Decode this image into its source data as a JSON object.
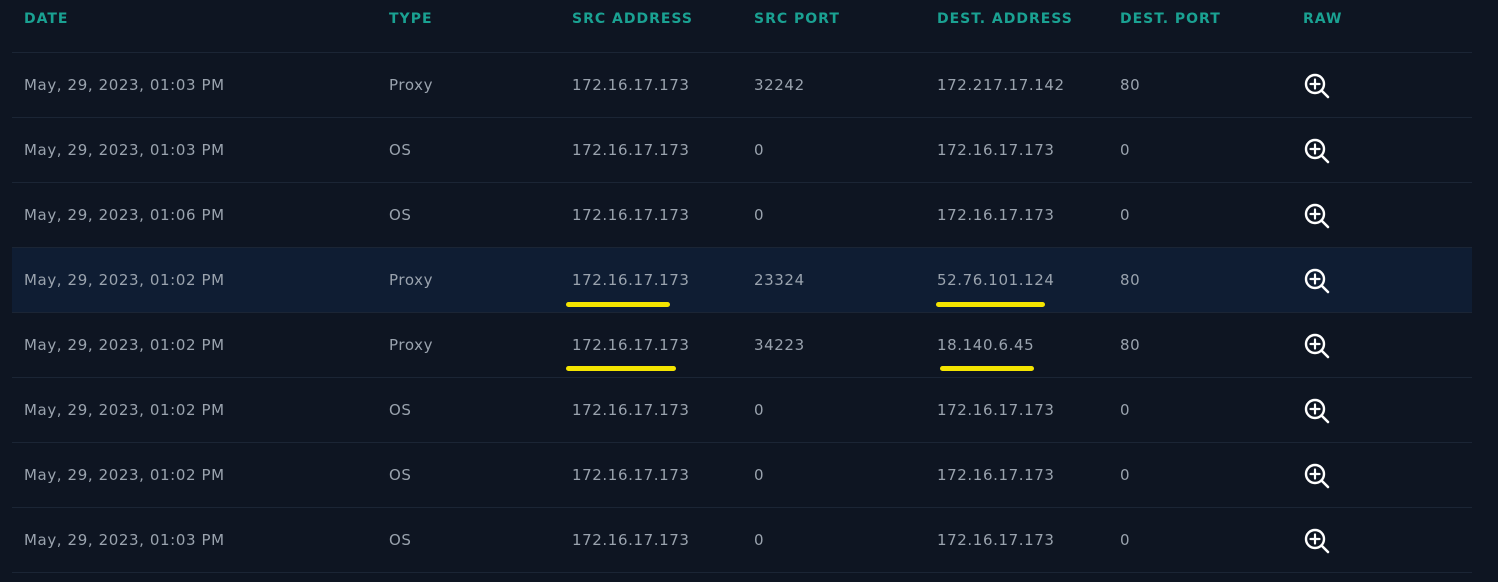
{
  "columns": {
    "date": "DATE",
    "type": "TYPE",
    "src_address": "SRC ADDRESS",
    "src_port": "SRC PORT",
    "dest_address": "DEST. ADDRESS",
    "dest_port": "DEST. PORT",
    "raw": "RAW"
  },
  "rows": [
    {
      "date": "May, 29, 2023, 01:03 PM",
      "type": "Proxy",
      "src_address": "172.16.17.173",
      "src_port": "32242",
      "dest_address": "172.217.17.142",
      "dest_port": "80"
    },
    {
      "date": "May, 29, 2023, 01:03 PM",
      "type": "OS",
      "src_address": "172.16.17.173",
      "src_port": "0",
      "dest_address": "172.16.17.173",
      "dest_port": "0"
    },
    {
      "date": "May, 29, 2023, 01:06 PM",
      "type": "OS",
      "src_address": "172.16.17.173",
      "src_port": "0",
      "dest_address": "172.16.17.173",
      "dest_port": "0"
    },
    {
      "date": "May, 29, 2023, 01:02 PM",
      "type": "Proxy",
      "src_address": "172.16.17.173",
      "src_port": "23324",
      "dest_address": "52.76.101.124",
      "dest_port": "80"
    },
    {
      "date": "May, 29, 2023, 01:02 PM",
      "type": "Proxy",
      "src_address": "172.16.17.173",
      "src_port": "34223",
      "dest_address": "18.140.6.45",
      "dest_port": "80"
    },
    {
      "date": "May, 29, 2023, 01:02 PM",
      "type": "OS",
      "src_address": "172.16.17.173",
      "src_port": "0",
      "dest_address": "172.16.17.173",
      "dest_port": "0"
    },
    {
      "date": "May, 29, 2023, 01:02 PM",
      "type": "OS",
      "src_address": "172.16.17.173",
      "src_port": "0",
      "dest_address": "172.16.17.173",
      "dest_port": "0"
    },
    {
      "date": "May, 29, 2023, 01:03 PM",
      "type": "OS",
      "src_address": "172.16.17.173",
      "src_port": "0",
      "dest_address": "172.16.17.173",
      "dest_port": "0"
    }
  ],
  "highlighted_row": 3,
  "annotated_rows": [
    3,
    4
  ],
  "raw_icon": "zoom-in-icon",
  "colors": {
    "background": "#0e1522",
    "header_text": "#1aa192",
    "cell_text": "#9aa3ae",
    "highlight_row": "#0f1d33",
    "annotation_underline": "#f4e400",
    "icon": "#ffffff"
  }
}
